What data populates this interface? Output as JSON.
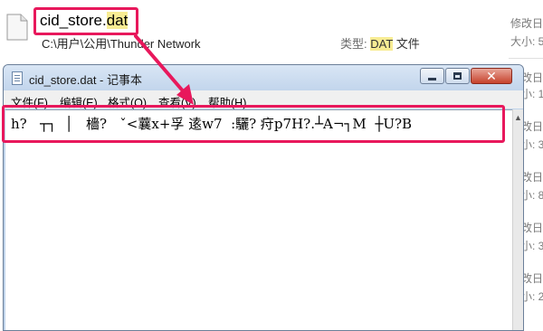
{
  "explorer": {
    "result": {
      "name_prefix": "cid_store.",
      "name_ext": "dat",
      "path": "C:\\用户\\公用\\Thunder Network",
      "type_label": "类型:",
      "type_value": "DAT",
      "type_suffix": "文件",
      "modified_label": "修改日",
      "size_label": "大小: 5"
    },
    "right_column": [
      "修改日",
      "大小: 1",
      "修改日",
      "大小: 3",
      "修改日",
      "大小: 8",
      "修改日",
      "大小: 3",
      "修改日",
      "大小: 2"
    ]
  },
  "notepad": {
    "title": "cid_store.dat - 记事本",
    "buttons": {
      "minimize": "minimize-icon",
      "maximize": "maximize-icon",
      "close": "✕"
    },
    "menu": [
      "文件(F)",
      "编辑(E)",
      "格式(O)",
      "查看(V)",
      "帮助(H)"
    ],
    "content": "h?   ┬┐  │   檣?   ˇ<蘘x+孚 逺w7  :驪? 疛p7H?.┴A¬┐M  ┼U?B"
  },
  "colors": {
    "annotation": "#e8185c",
    "highlight": "#f8ec93"
  }
}
